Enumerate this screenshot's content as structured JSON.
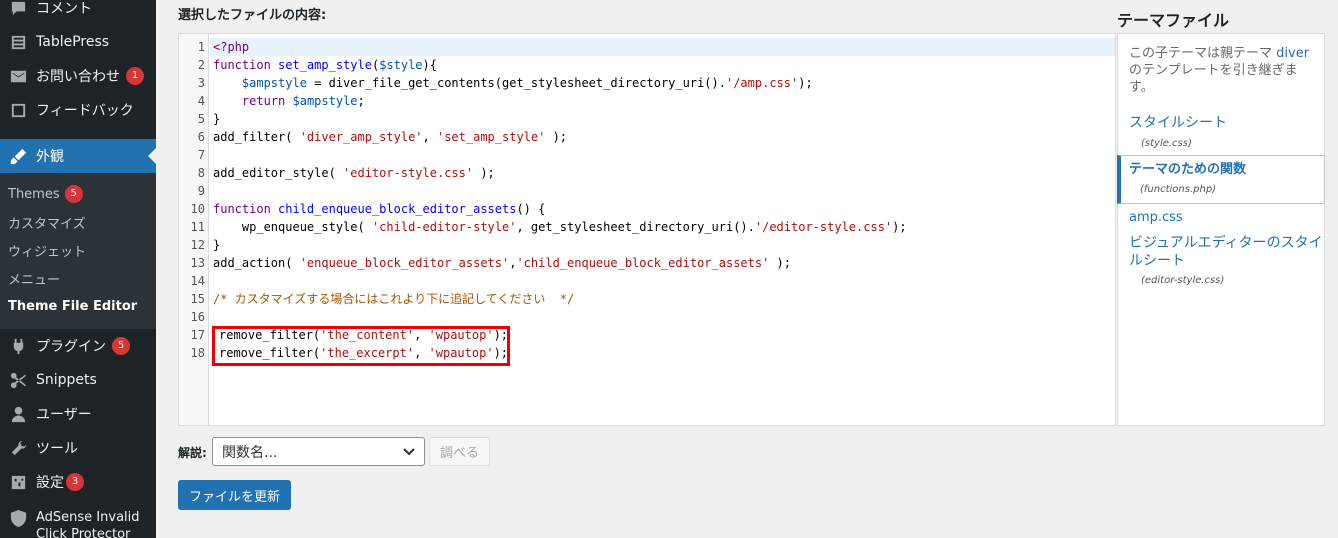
{
  "sidebar": {
    "comments": "コメント",
    "tablepress": "TablePress",
    "contact": "お問い合わせ",
    "contact_badge": "1",
    "feedback": "フィードバック",
    "appearance": "外観",
    "submenu": {
      "themes": "Themes",
      "themes_badge": "5",
      "customize": "カスタマイズ",
      "widgets": "ウィジェット",
      "menus": "メニュー",
      "editor": "Theme File Editor"
    },
    "plugins": "プラグイン",
    "plugins_badge": "5",
    "snippets": "Snippets",
    "users": "ユーザー",
    "tools": "ツール",
    "settings": "設定",
    "settings_badge": "3",
    "adsense1": "AdSense Invalid",
    "adsense2": "Click Protector"
  },
  "heading": "選択したファイルの内容:",
  "editor": {
    "line_numbers": [
      "1",
      "2",
      "3",
      "4",
      "5",
      "6",
      "7",
      "8",
      "9",
      "10",
      "11",
      "12",
      "13",
      "14",
      "15",
      "16",
      "17",
      "18"
    ]
  },
  "docs": {
    "label": "解説:",
    "select_value": "関数名...",
    "lookup": "調べる"
  },
  "update_button": "ファイルを更新",
  "theme_files": {
    "title": "テーマファイル",
    "note_prefix": "この子テーマは親テーマ",
    "parent": "diver",
    "note_suffix": "のテンプレートを引き継ぎます。",
    "files": [
      {
        "label": "スタイルシート",
        "file": "(style.css)"
      },
      {
        "label": "テーマのための関数",
        "file": "(functions.php)"
      },
      {
        "label": "amp.css",
        "file": ""
      },
      {
        "label": "ビジュアルエディターのスタイルシート",
        "file": "(editor-style.css)"
      }
    ]
  }
}
